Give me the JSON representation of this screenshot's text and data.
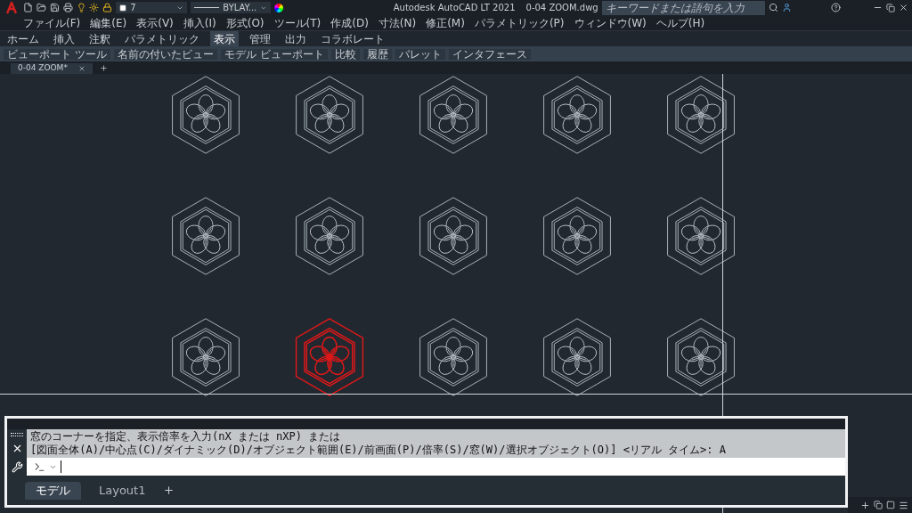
{
  "title_bar": {
    "app_title": "Autodesk AutoCAD LT 2021",
    "file_name": "0-04 ZOOM.dwg",
    "layer": "7",
    "linetype": "BYLAY...",
    "search": {
      "placeholder": "キーワードまたは語句を入力"
    }
  },
  "menu": [
    "ファイル(F)",
    "編集(E)",
    "表示(V)",
    "挿入(I)",
    "形式(O)",
    "ツール(T)",
    "作成(D)",
    "寸法(N)",
    "修正(M)",
    "パラメトリック(P)",
    "ウィンドウ(W)",
    "ヘルプ(H)"
  ],
  "ribbon_tabs": [
    {
      "label": "ホーム",
      "selected": false
    },
    {
      "label": "挿入",
      "selected": false
    },
    {
      "label": "注釈",
      "selected": false
    },
    {
      "label": "パラメトリック",
      "selected": false
    },
    {
      "label": "表示",
      "selected": true
    },
    {
      "label": "管理",
      "selected": false
    },
    {
      "label": "出力",
      "selected": false
    },
    {
      "label": "コラボレート",
      "selected": false
    }
  ],
  "ribbon_panels": [
    "ビューポート ツール",
    "名前の付いたビュー",
    "モデル ビューポート",
    "比較",
    "履歴",
    "パレット",
    "インタフェース"
  ],
  "file_tabs": [
    {
      "label": "0-04 ZOOM*",
      "selected": true
    }
  ],
  "emblems": [
    {
      "selected": false
    },
    {
      "selected": false
    },
    {
      "selected": false
    },
    {
      "selected": false
    },
    {
      "selected": false
    },
    {
      "selected": false
    },
    {
      "selected": false
    },
    {
      "selected": false
    },
    {
      "selected": false
    },
    {
      "selected": false
    },
    {
      "selected": false
    },
    {
      "selected": true
    },
    {
      "selected": false
    },
    {
      "selected": false
    },
    {
      "selected": false
    }
  ],
  "command": {
    "history": [
      "窓のコーナーを指定、表示倍率を入力(nX または nXP) または",
      "[図面全体(A)/中心点(C)/ダイナミック(D)/オブジェクト範囲(E)/前画面(P)/倍率(S)/窓(W)/選択オブジェクト(O)] <リアル タイム>: A"
    ]
  },
  "layout_tabs": [
    {
      "label": "モデル",
      "selected": true
    },
    {
      "label": "Layout1",
      "selected": false
    }
  ]
}
